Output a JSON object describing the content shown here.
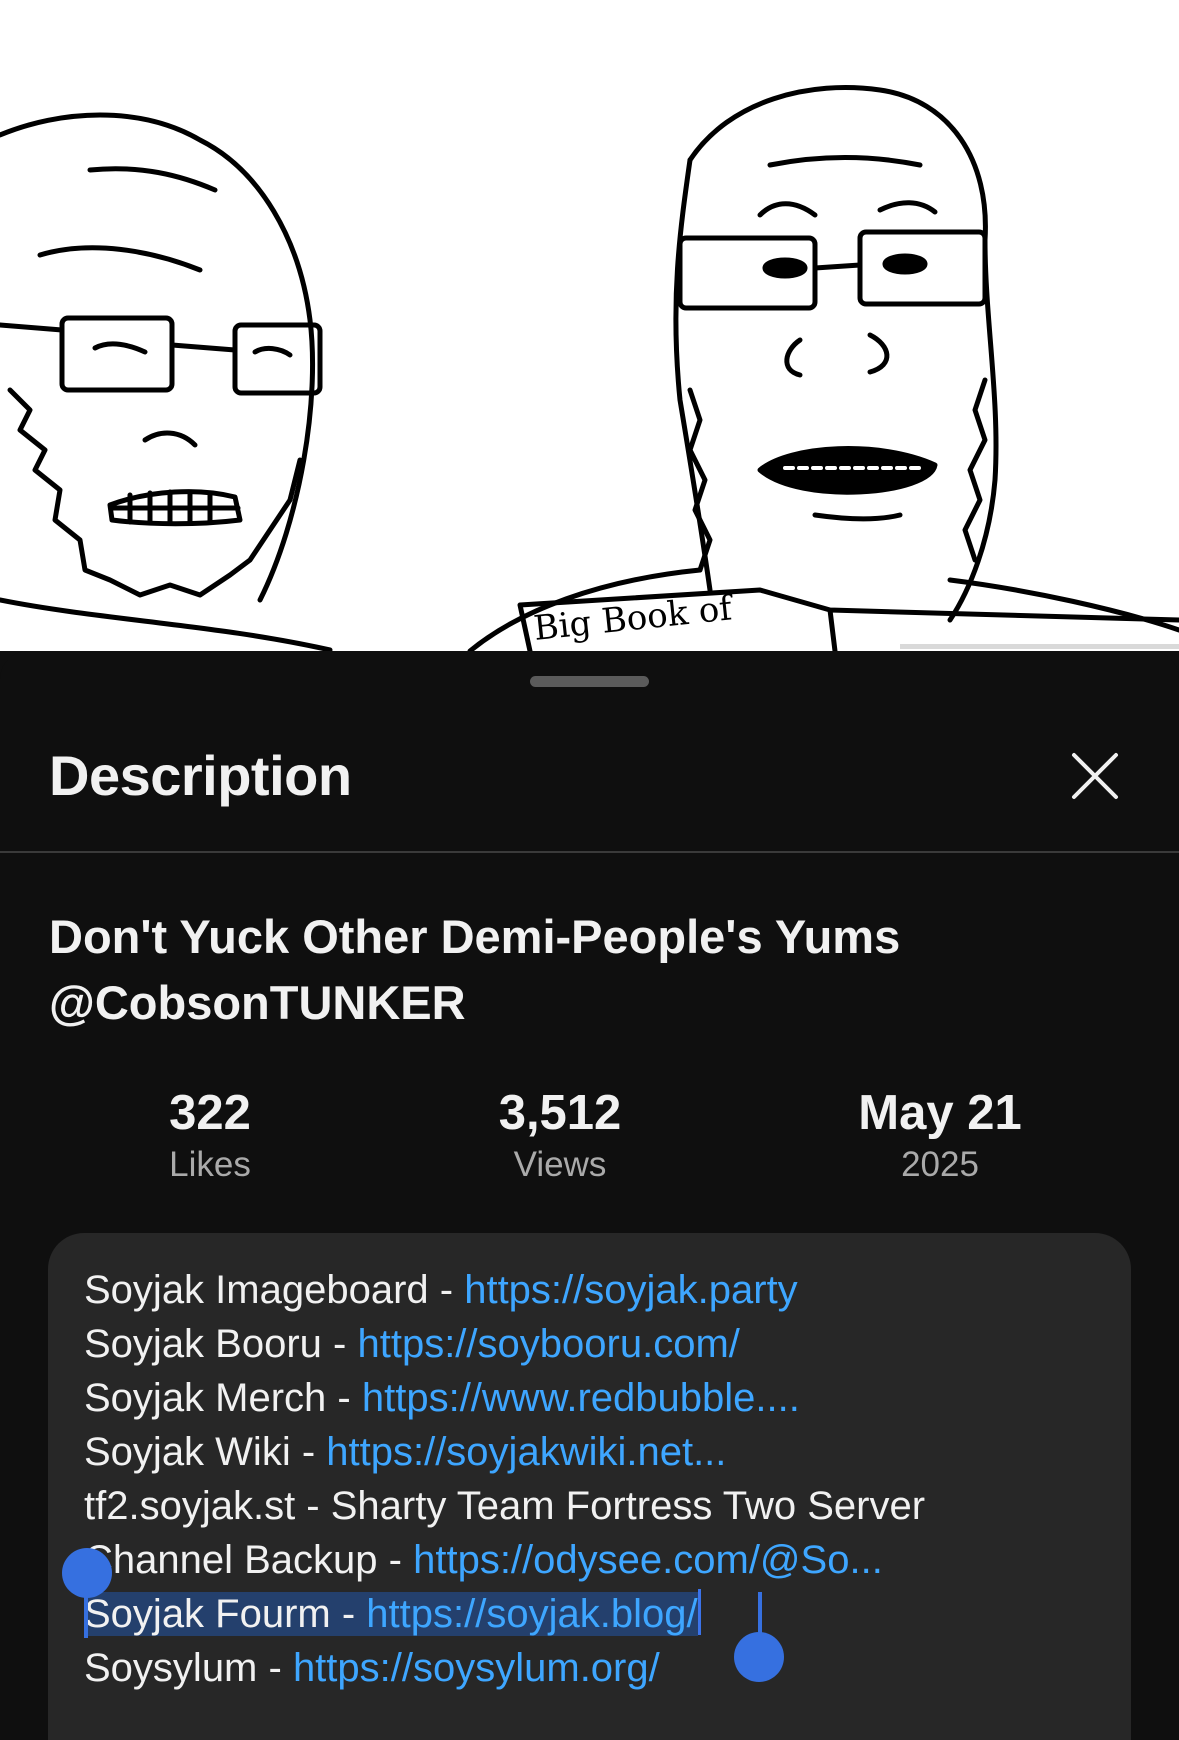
{
  "video": {
    "drawn_text": "Big Book of"
  },
  "sheet": {
    "title": "Description",
    "close_icon": "close-icon"
  },
  "video_title": "Don't Yuck Other Demi-People's Yums @CobsonTUNKER",
  "stats": [
    {
      "value": "322",
      "label": "Likes"
    },
    {
      "value": "3,512",
      "label": "Views"
    },
    {
      "value": "May 21",
      "label": "2025"
    }
  ],
  "description": {
    "lines": [
      {
        "text": "Soyjak Imageboard - ",
        "link": "https://soyjak.party"
      },
      {
        "text": "Soyjak Booru - ",
        "link": "https://soybooru.com/"
      },
      {
        "text": "Soyjak Merch - ",
        "link": "https://www.redbubble...."
      },
      {
        "text": "Soyjak Wiki - ",
        "link": "https://soyjakwiki.net..."
      },
      {
        "text": "tf2.soyjak.st - Sharty Team Fortress Two Server",
        "link": ""
      },
      {
        "text": "Channel Backup - ",
        "link": "https://odysee.com/@So..."
      },
      {
        "text": "Soyjak Fourm - ",
        "link": "https://soyjak.blog/",
        "selected": true
      },
      {
        "text": "Soysylum - ",
        "link": "https://soysylum.org/"
      }
    ]
  },
  "colors": {
    "background": "#0f0f0f",
    "description_box": "#272727",
    "link": "#3ea6ff",
    "selection": "#24406d",
    "selection_handle": "#3670e0"
  }
}
